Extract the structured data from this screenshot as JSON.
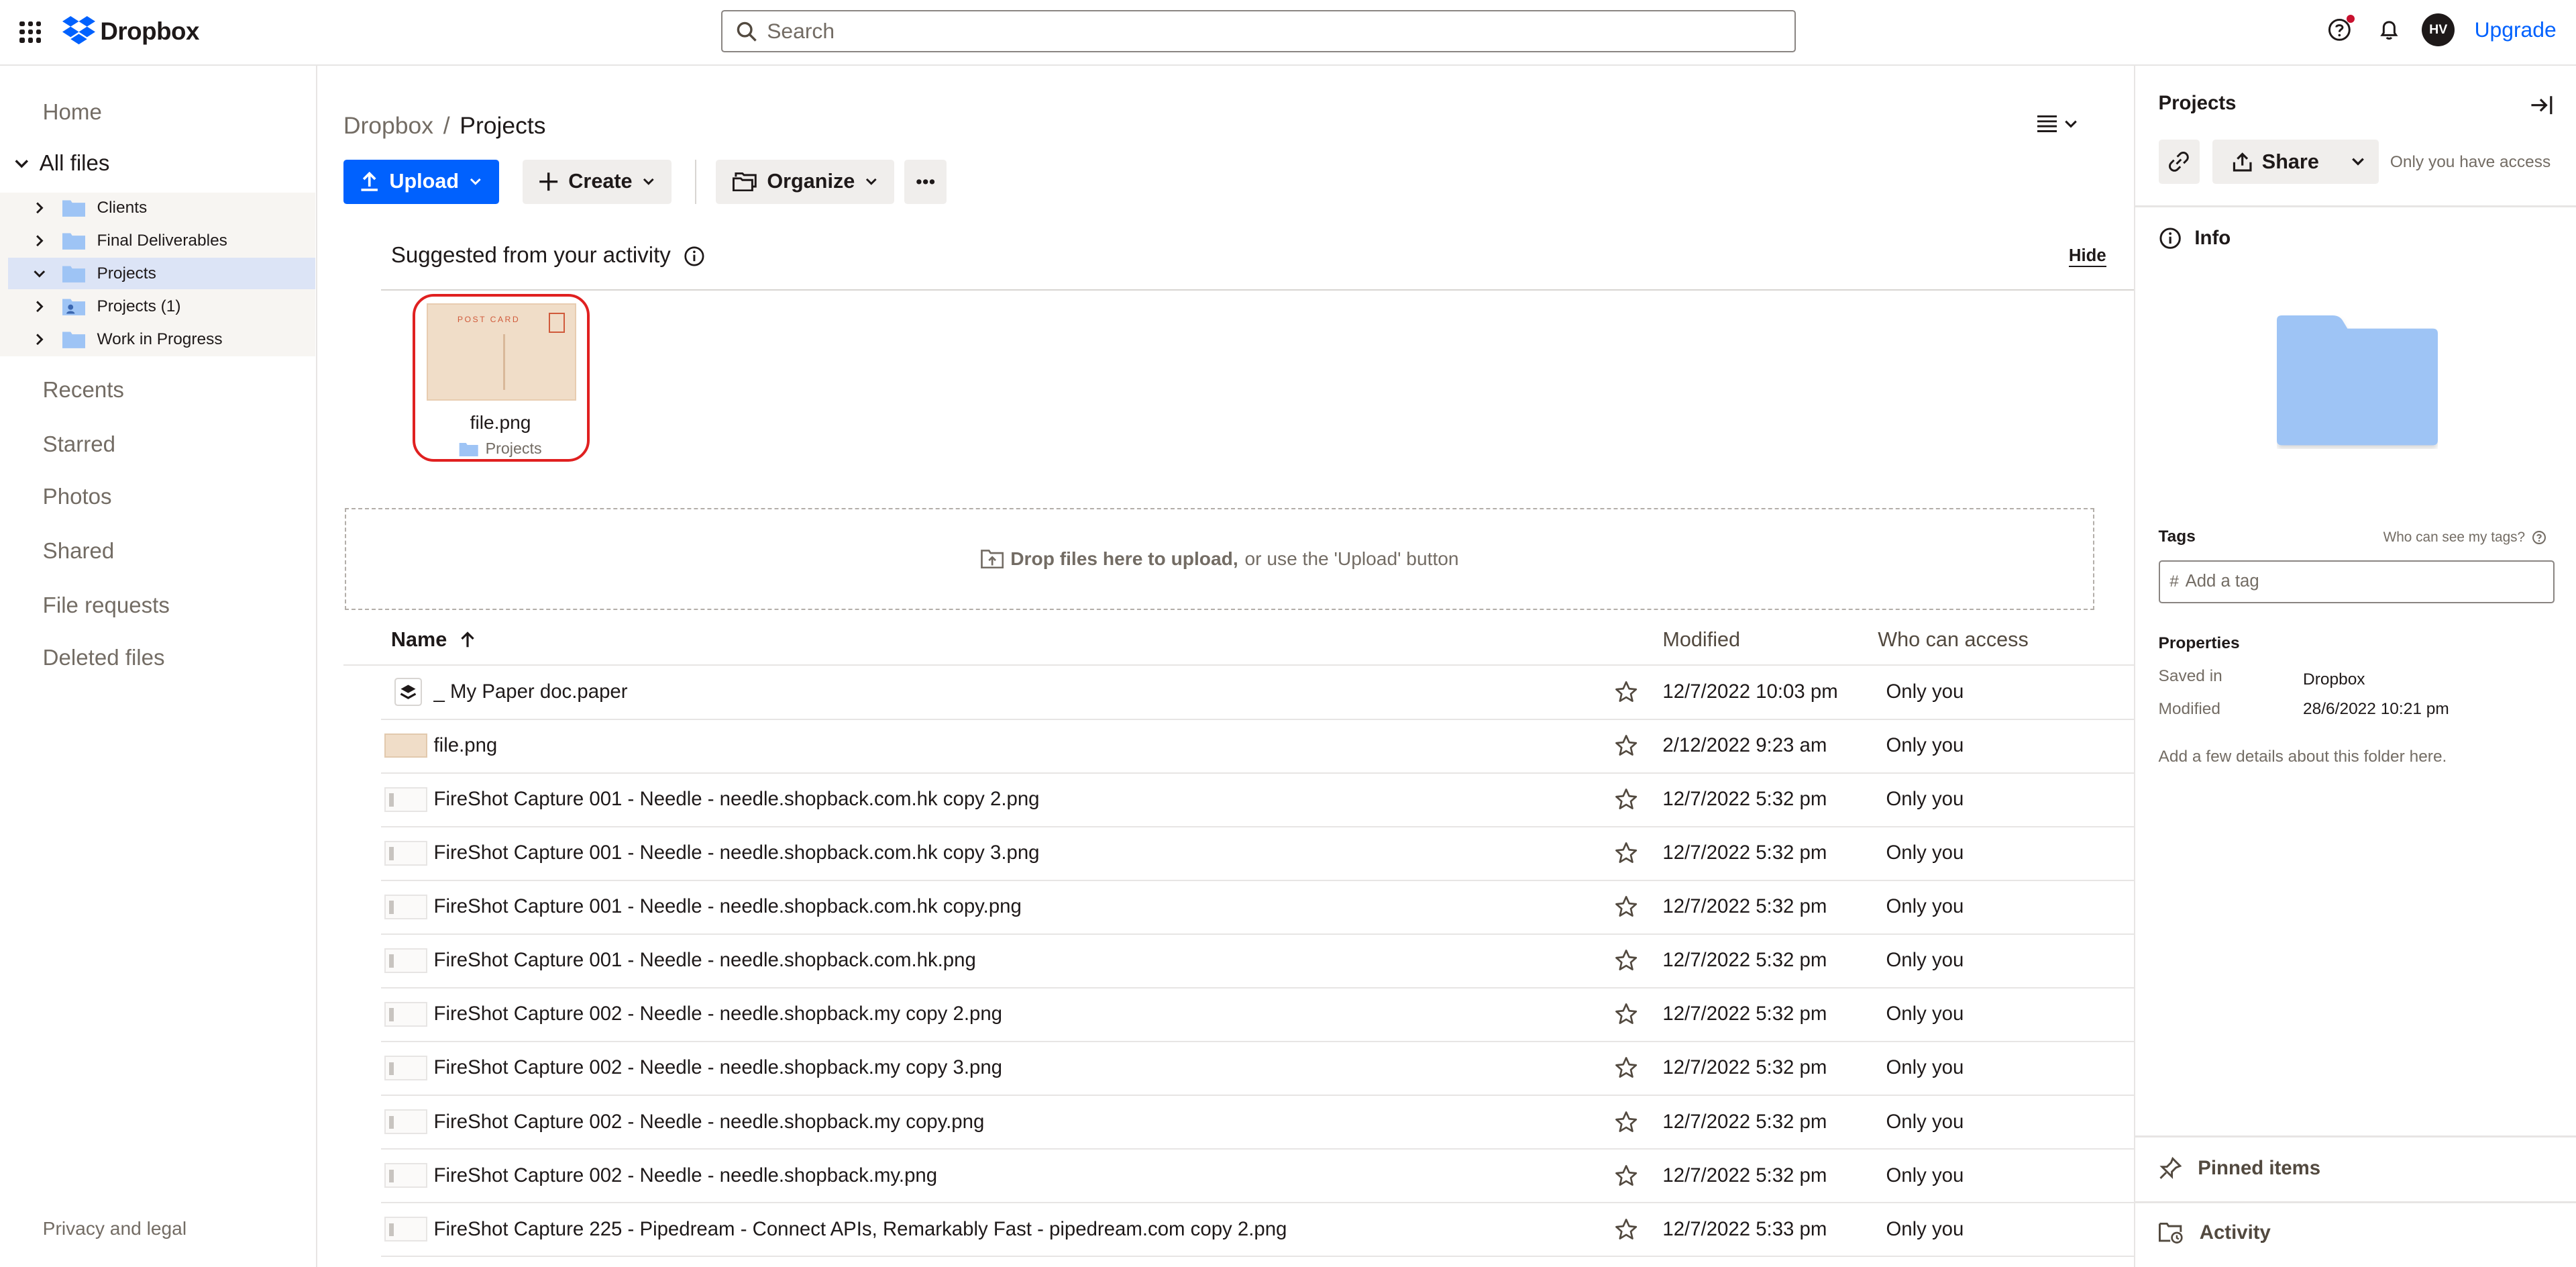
{
  "app": {
    "logo_text": "Dropbox",
    "upgrade_label": "Upgrade",
    "avatar_initials": "HV"
  },
  "search": {
    "placeholder": "Search"
  },
  "sidebar": {
    "home": "Home",
    "all_files": "All files",
    "tree": [
      {
        "label": "Clients",
        "expanded": false,
        "active": false,
        "icon": "folder-icon"
      },
      {
        "label": "Final Deliverables",
        "expanded": false,
        "active": false,
        "icon": "folder-icon"
      },
      {
        "label": "Projects",
        "expanded": true,
        "active": true,
        "icon": "folder-icon"
      },
      {
        "label": "Projects (1)",
        "expanded": false,
        "active": false,
        "icon": "shared-folder-icon"
      },
      {
        "label": "Work in Progress",
        "expanded": false,
        "active": false,
        "icon": "folder-icon"
      }
    ],
    "recents": "Recents",
    "starred": "Starred",
    "photos": "Photos",
    "shared": "Shared",
    "file_requests": "File requests",
    "deleted_files": "Deleted files",
    "privacy": "Privacy and legal"
  },
  "breadcrumb": {
    "root": "Dropbox",
    "separator": "/",
    "current": "Projects"
  },
  "toolbar": {
    "upload": "Upload",
    "create": "Create",
    "organize": "Organize"
  },
  "suggested": {
    "title": "Suggested from your activity",
    "hide": "Hide",
    "card": {
      "name": "file.png",
      "location": "Projects",
      "thumb_text": "POST CARD"
    }
  },
  "dropzone": {
    "bold": "Drop files here to upload,",
    "rest": "or use the 'Upload' button"
  },
  "table": {
    "headers": {
      "name": "Name",
      "modified": "Modified",
      "access": "Who can access"
    },
    "rows": [
      {
        "name": "_ My Paper doc.paper",
        "modified": "12/7/2022 10:03 pm",
        "access": "Only you",
        "thumb": "paper"
      },
      {
        "name": "file.png",
        "modified": "2/12/2022 9:23 am",
        "access": "Only you",
        "thumb": "image"
      },
      {
        "name": "FireShot Capture 001 - Needle - needle.shopback.com.hk copy 2.png",
        "modified": "12/7/2022 5:32 pm",
        "access": "Only you",
        "thumb": "shot"
      },
      {
        "name": "FireShot Capture 001 - Needle - needle.shopback.com.hk copy 3.png",
        "modified": "12/7/2022 5:32 pm",
        "access": "Only you",
        "thumb": "shot"
      },
      {
        "name": "FireShot Capture 001 - Needle - needle.shopback.com.hk copy.png",
        "modified": "12/7/2022 5:32 pm",
        "access": "Only you",
        "thumb": "shot"
      },
      {
        "name": "FireShot Capture 001 - Needle - needle.shopback.com.hk.png",
        "modified": "12/7/2022 5:32 pm",
        "access": "Only you",
        "thumb": "shot"
      },
      {
        "name": "FireShot Capture 002 - Needle - needle.shopback.my copy 2.png",
        "modified": "12/7/2022 5:32 pm",
        "access": "Only you",
        "thumb": "shot"
      },
      {
        "name": "FireShot Capture 002 - Needle - needle.shopback.my copy 3.png",
        "modified": "12/7/2022 5:32 pm",
        "access": "Only you",
        "thumb": "shot"
      },
      {
        "name": "FireShot Capture 002 - Needle - needle.shopback.my copy.png",
        "modified": "12/7/2022 5:32 pm",
        "access": "Only you",
        "thumb": "shot"
      },
      {
        "name": "FireShot Capture 002 - Needle - needle.shopback.my.png",
        "modified": "12/7/2022 5:32 pm",
        "access": "Only you",
        "thumb": "shot"
      },
      {
        "name": "FireShot Capture 225 - Pipedream - Connect APIs, Remarkably Fast - pipedream.com copy 2.png",
        "modified": "12/7/2022 5:33 pm",
        "access": "Only you",
        "thumb": "shot"
      }
    ]
  },
  "panel": {
    "title": "Projects",
    "share": "Share",
    "access": "Only you have access",
    "info": "Info",
    "tags": "Tags",
    "tags_help": "Who can see my tags?",
    "tag_placeholder": "Add a tag",
    "tag_hash": "#",
    "properties": "Properties",
    "saved_in_key": "Saved in",
    "saved_in_val": "Dropbox",
    "modified_key": "Modified",
    "modified_val": "28/6/2022 10:21 pm",
    "details": "Add a few details about this folder here.",
    "pinned": "Pinned items",
    "activity": "Activity"
  },
  "colors": {
    "accent": "#0061fe",
    "highlight": "#e02020",
    "folder": "#9ec4f5",
    "active_row": "#dce4f6"
  }
}
